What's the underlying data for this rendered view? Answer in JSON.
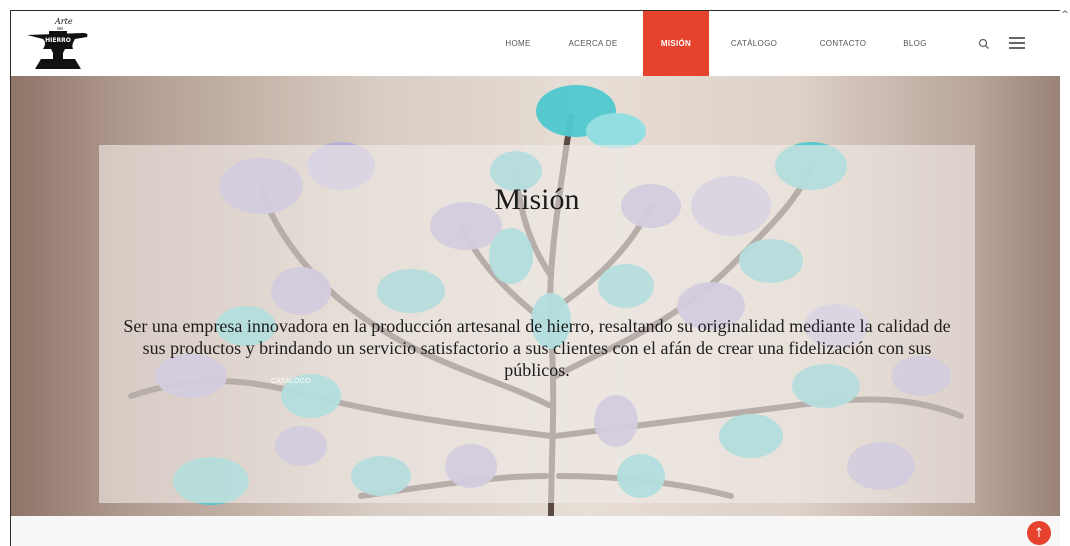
{
  "brand": {
    "logo_line1": "Arte",
    "logo_line2": "del",
    "logo_line3": "HIERRO",
    "logo_icon": "anvil-logo"
  },
  "nav": {
    "items": [
      {
        "label": "HOME"
      },
      {
        "label": "ACERCA DE"
      },
      {
        "label": "MISIÓN",
        "active": true
      },
      {
        "label": "CATÁLOGO"
      },
      {
        "label": "CONTACTO"
      },
      {
        "label": "BLOG"
      }
    ],
    "search_icon": "search-icon",
    "menu_icon": "hamburger-menu-icon"
  },
  "hero": {
    "title": "Misión",
    "text": "Ser una empresa innovadora en la producción artesanal de hierro, resaltando su originalidad mediante la calidad de sus productos y brindando un servicio satisfactorio a sus clientes con el afán de crear una fidelización con sus públicos.",
    "ghost_label": "CATÁLOGO"
  },
  "scroll_top": {
    "icon": "arrow-up-icon",
    "glyph": "↑"
  },
  "scrollbar": {
    "glyph": "^"
  },
  "colors": {
    "accent": "#e5432d",
    "leaf_teal": "#4fc9cf",
    "leaf_lilac": "#a39bd0",
    "branch": "#5b4a44"
  }
}
